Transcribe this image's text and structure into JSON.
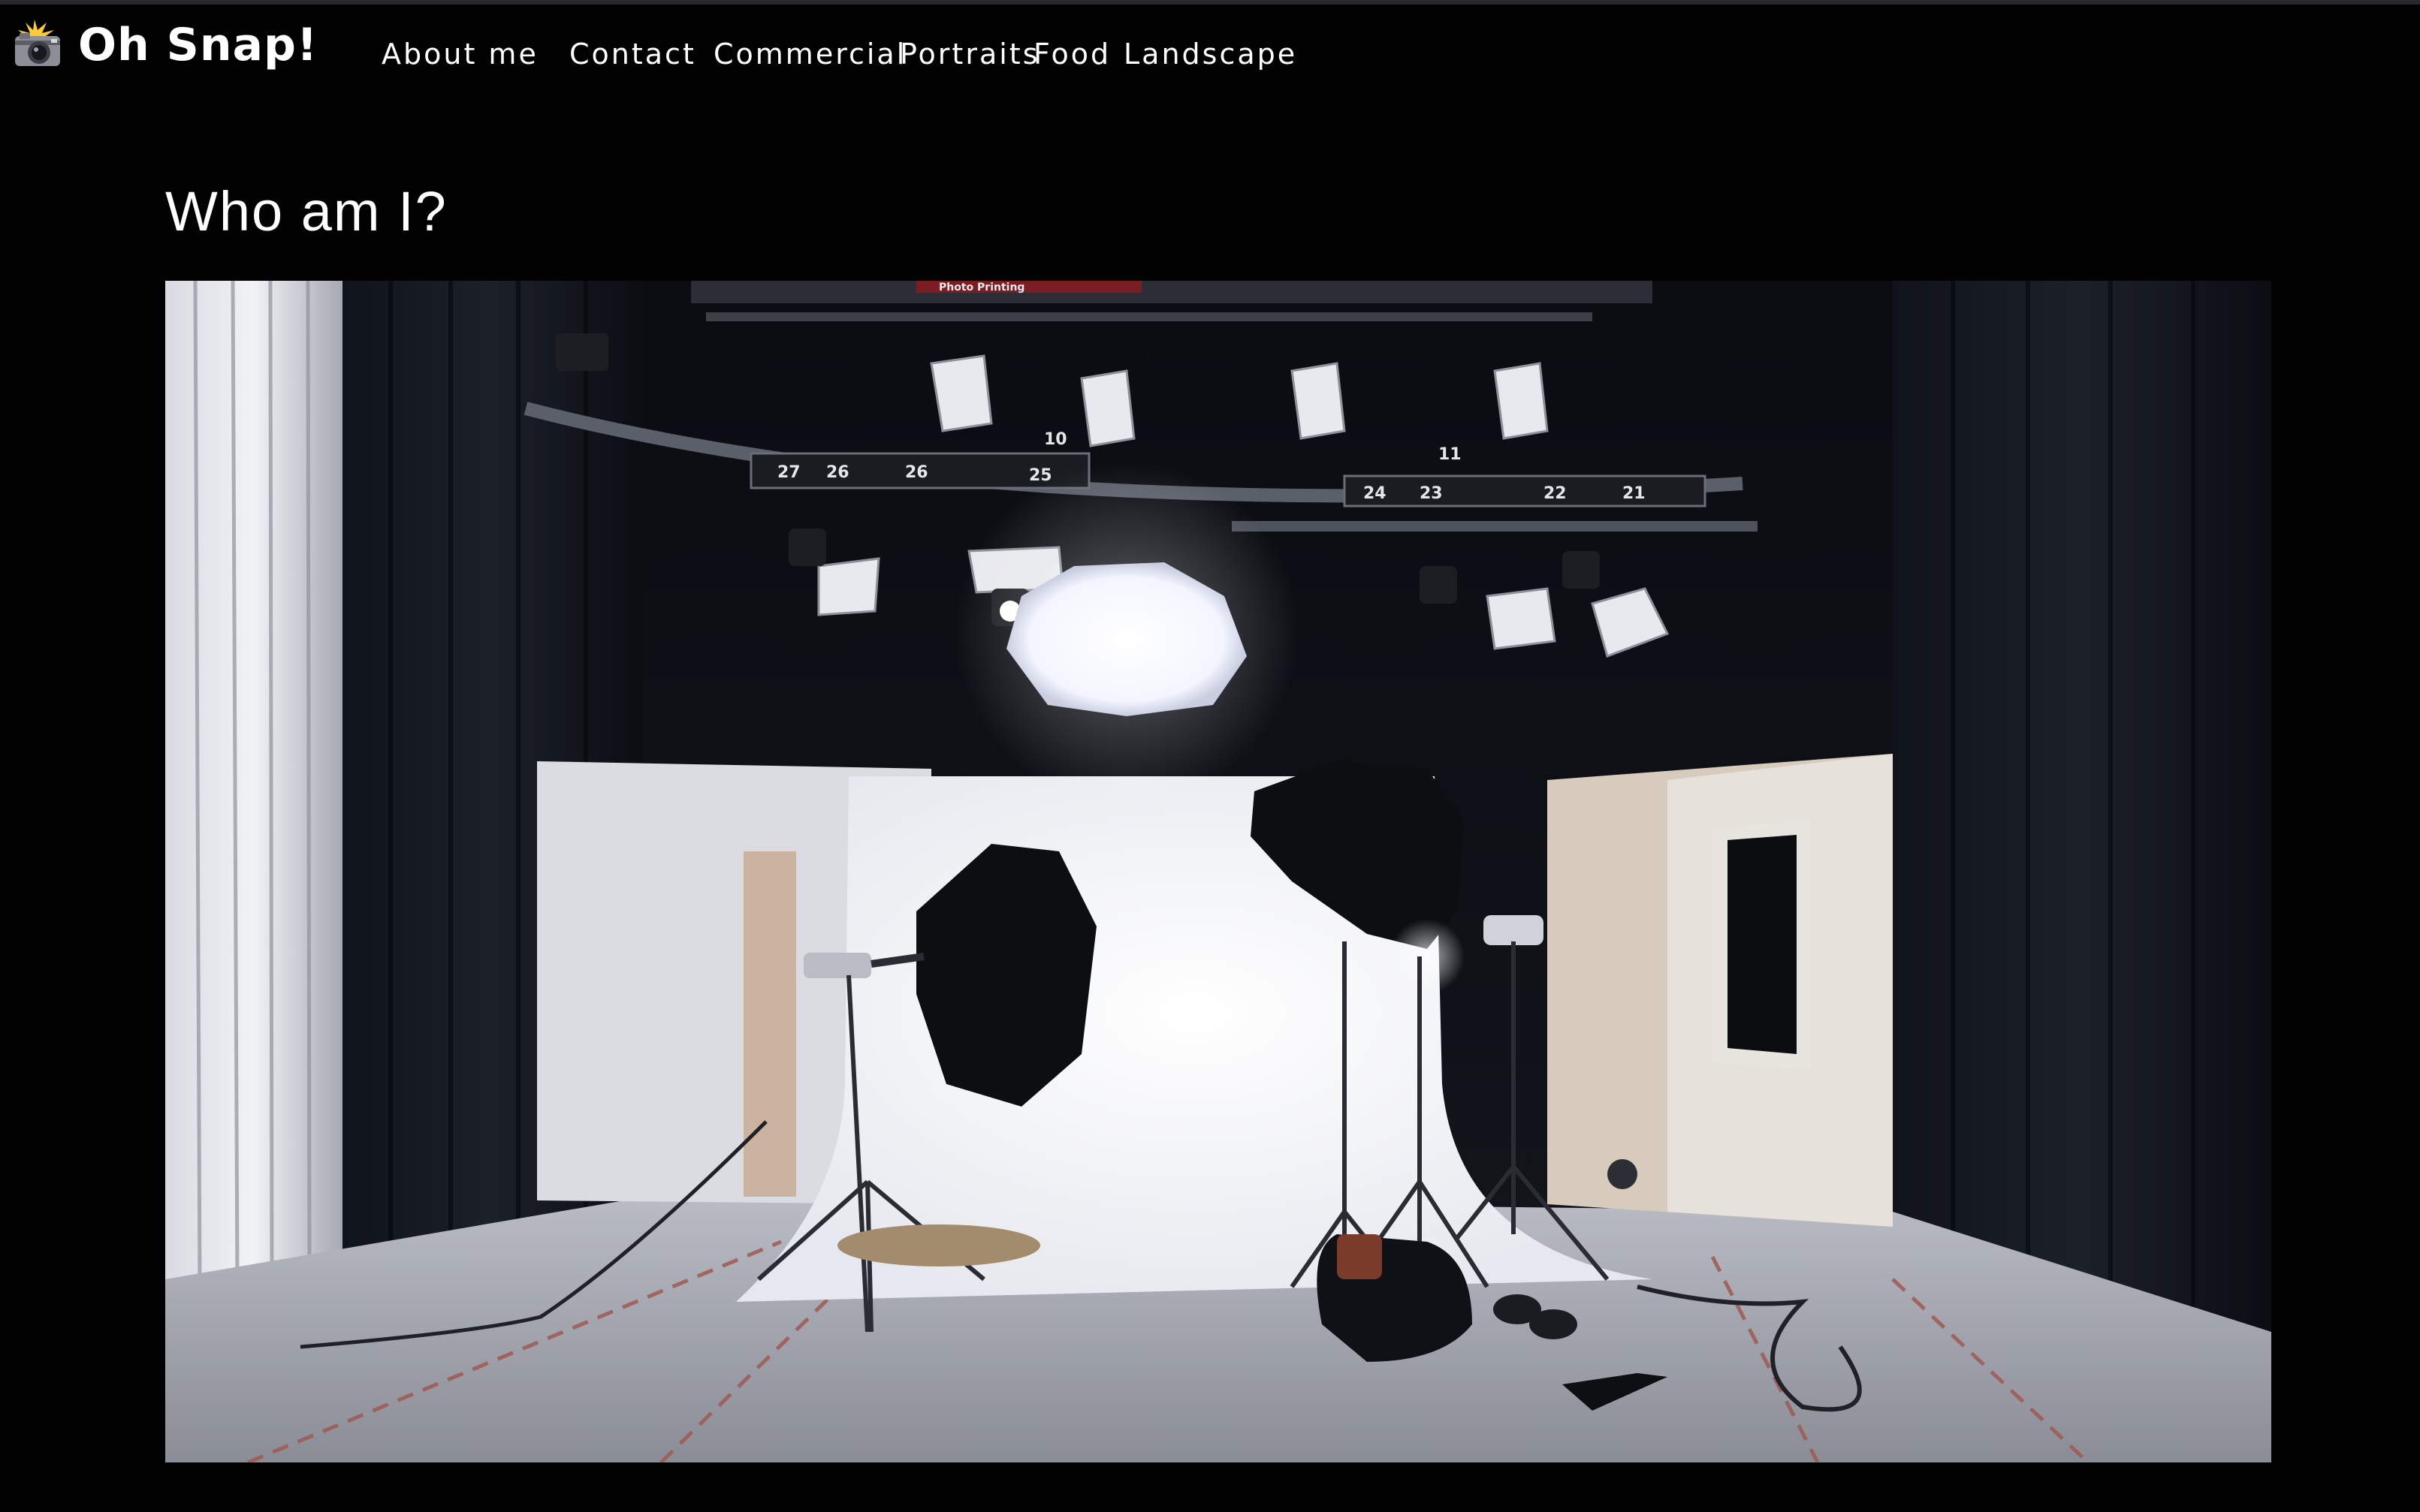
{
  "header": {
    "brand": {
      "icon": "camera-flash-icon",
      "title": "Oh Snap!"
    },
    "nav": [
      {
        "label": "About me"
      },
      {
        "label": "Contact"
      },
      {
        "label": "Commercial"
      },
      {
        "label": "Portraits"
      },
      {
        "label": "Food"
      },
      {
        "label": "Landscape"
      }
    ]
  },
  "main": {
    "heading": "Who am I?",
    "hero_image": {
      "subject": "photo-studio-photo"
    }
  },
  "studio_signs": {
    "banner": "Photo Printing",
    "numbers": [
      "27",
      "26",
      "26",
      "25",
      "10",
      "11",
      "24",
      "23",
      "22",
      "21"
    ]
  },
  "colors": {
    "background": "#020203",
    "text": "#ffffff"
  }
}
